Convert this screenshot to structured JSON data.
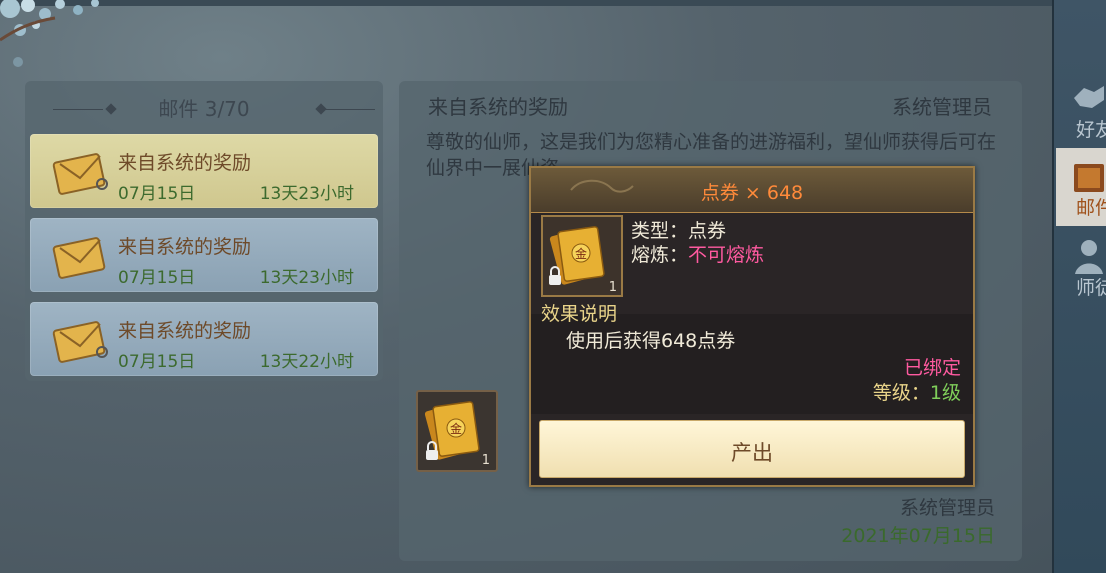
{
  "mail_list": {
    "header": "邮件 3/70",
    "items": [
      {
        "title": "来自系统的奖励",
        "date": "07月15日",
        "remaining": "13天23小时"
      },
      {
        "title": "来自系统的奖励",
        "date": "07月15日",
        "remaining": "13天23小时"
      },
      {
        "title": "来自系统的奖励",
        "date": "07月15日",
        "remaining": "13天22小时"
      }
    ]
  },
  "mail_detail": {
    "title": "来自系统的奖励",
    "sender": "系统管理员",
    "body": "尊敬的仙师，这是我们为您精心准备的进游福利，望仙师获得后可在仙界中一展仙姿。",
    "footer_sender": "系统管理员",
    "footer_date": "2021年07月15日",
    "attachment": {
      "icon": "gold-voucher-icon",
      "count": "1"
    }
  },
  "tooltip": {
    "title": "点券 × 648",
    "type_label": "类型：",
    "type_value": "点券",
    "smelt_label": "熔炼：",
    "smelt_value": "不可熔炼",
    "item_count": "1",
    "effect_heading": "效果说明",
    "effect_text": "使用后获得648点券",
    "bound_text": "已绑定",
    "level_label": "等级：",
    "level_value": "1级",
    "button_label": "产出"
  },
  "side_tabs": [
    {
      "label": "好友",
      "icon": "handshake-icon",
      "active": false
    },
    {
      "label": "邮件",
      "icon": "mail-book-icon",
      "active": true
    },
    {
      "label": "师徒",
      "icon": "master-apprentice-icon",
      "active": false
    }
  ],
  "colors": {
    "accent_orange": "#ff8a3a",
    "pink_value": "#ff5aa0",
    "green_value": "#7fce5a",
    "gold_text": "#e9d48a"
  }
}
